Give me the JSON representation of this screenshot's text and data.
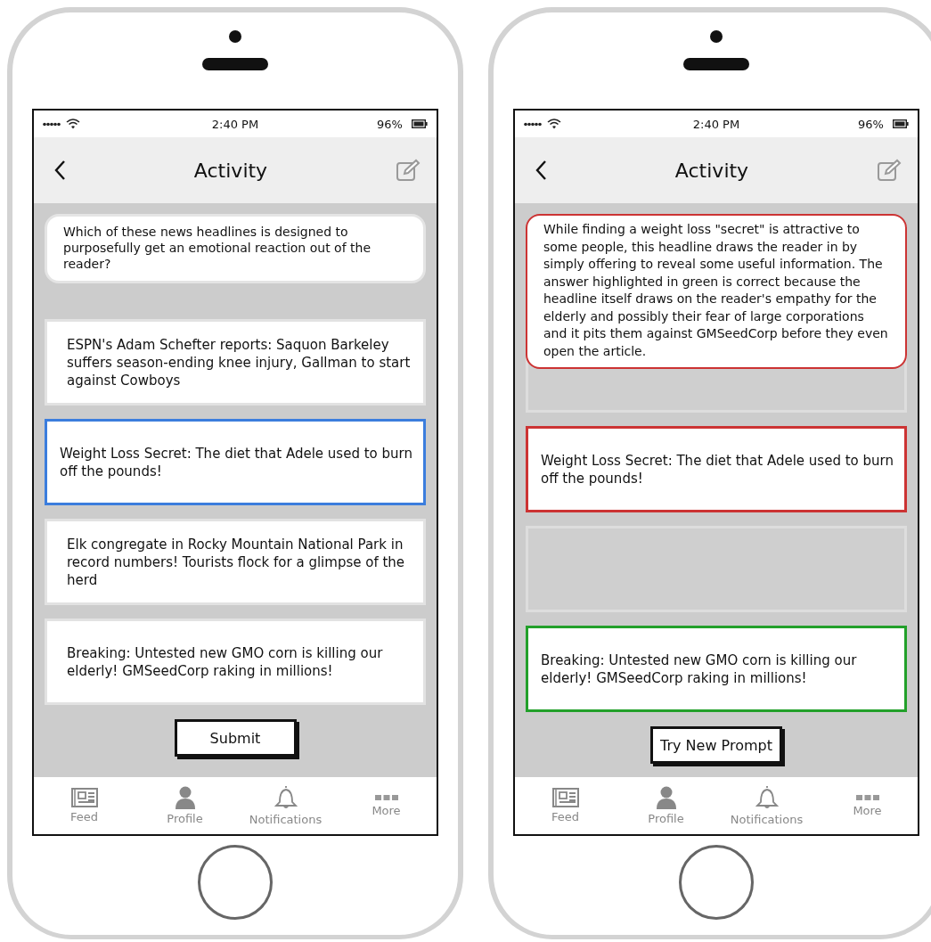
{
  "phones": [
    {
      "status": {
        "time": "2:40 PM",
        "battery": "96%"
      },
      "nav": {
        "title": "Activity"
      },
      "prompt": {
        "kind": "question",
        "text": "Which of these news headlines is designed to purposefully get an emotional reaction out of the reader?"
      },
      "options": [
        {
          "kind": "answer",
          "text": "ESPN's Adam Schefter reports: Saquon Barkeley suffers season-ending knee injury, Gallman to start against Cowboys",
          "selected": false
        },
        {
          "kind": "answer",
          "text": "Weight Loss Secret: The diet that Adele used to burn off the pounds!",
          "selected": true
        },
        {
          "kind": "answer",
          "text": "Elk congregate in Rocky Mountain National Park in record numbers! Tourists flock for a glimpse of the herd",
          "selected": false
        },
        {
          "kind": "answer",
          "text": "Breaking: Untested new GMO corn is killing our elderly! GMSeedCorp raking in millions!",
          "selected": false
        }
      ],
      "button": "Submit",
      "tabs": [
        "Feed",
        "Profile",
        "Notifications",
        "More"
      ]
    },
    {
      "status": {
        "time": "2:40 PM",
        "battery": "96%"
      },
      "nav": {
        "title": "Activity"
      },
      "prompt": {
        "kind": "explanation",
        "text": "While finding a weight loss \"secret\" is attractive to some people, this headline draws the reader in by simply offering to reveal some useful information. The answer highlighted in green is correct because the headline itself draws on the reader's empathy for the elderly and possibly their fear of large corporations and it pits them against GMSeedCorp before they even open the article."
      },
      "options": [
        {
          "kind": "blank"
        },
        {
          "kind": "answer",
          "text": "Weight Loss Secret: The diet that Adele used to burn off the pounds!",
          "correct": false
        },
        {
          "kind": "blank"
        },
        {
          "kind": "answer",
          "text": "Breaking: Untested new GMO corn is killing our elderly! GMSeedCorp raking in millions!",
          "correct": true
        }
      ],
      "button": "Try New Prompt",
      "tabs": [
        "Feed",
        "Profile",
        "Notifications",
        "More"
      ]
    }
  ]
}
